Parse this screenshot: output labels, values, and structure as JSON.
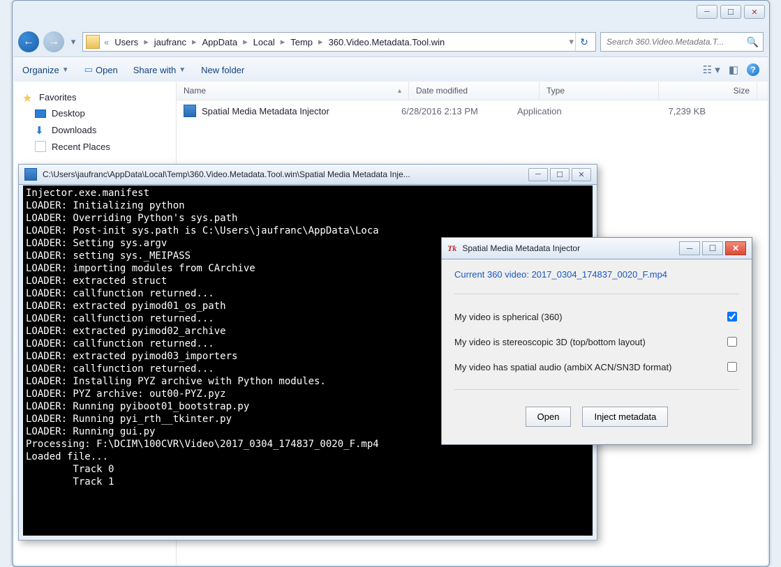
{
  "explorer": {
    "breadcrumb": {
      "prefix": "«",
      "items": [
        "Users",
        "jaufranc",
        "AppData",
        "Local",
        "Temp",
        "360.Video.Metadata.Tool.win"
      ]
    },
    "search_placeholder": "Search 360.Video.Metadata.T...",
    "toolbar": {
      "organize": "Organize",
      "open": "Open",
      "share": "Share with",
      "newfolder": "New folder"
    },
    "sidebar": {
      "favorites": "Favorites",
      "desktop": "Desktop",
      "downloads": "Downloads",
      "recent": "Recent Places"
    },
    "columns": {
      "name": "Name",
      "date": "Date modified",
      "type": "Type",
      "size": "Size"
    },
    "files": [
      {
        "name": "Spatial Media Metadata Injector",
        "date": "6/28/2016 2:13 PM",
        "type": "Application",
        "size": "7,239 KB"
      }
    ]
  },
  "console": {
    "title": "C:\\Users\\jaufranc\\AppData\\Local\\Temp\\360.Video.Metadata.Tool.win\\Spatial Media Metadata Inje...",
    "lines": [
      "Injector.exe.manifest",
      "LOADER: Initializing python",
      "LOADER: Overriding Python's sys.path",
      "LOADER: Post-init sys.path is C:\\Users\\jaufranc\\AppData\\Loca",
      "LOADER: Setting sys.argv",
      "LOADER: setting sys._MEIPASS",
      "LOADER: importing modules from CArchive",
      "LOADER: extracted struct",
      "LOADER: callfunction returned...",
      "LOADER: extracted pyimod01_os_path",
      "LOADER: callfunction returned...",
      "LOADER: extracted pyimod02_archive",
      "LOADER: callfunction returned...",
      "LOADER: extracted pyimod03_importers",
      "LOADER: callfunction returned...",
      "LOADER: Installing PYZ archive with Python modules.",
      "LOADER: PYZ archive: out00-PYZ.pyz",
      "LOADER: Running pyiboot01_bootstrap.py",
      "LOADER: Running pyi_rth__tkinter.py",
      "LOADER: Running gui.py",
      "Processing: F:\\DCIM\\100CVR\\Video\\2017_0304_174837_0020_F.mp4",
      "Loaded file...",
      "        Track 0",
      "        Track 1"
    ]
  },
  "injector": {
    "title": "Spatial Media Metadata Injector",
    "current_label": "Current 360 video: 2017_0304_174837_0020_F.mp4",
    "opt_spherical": "My video is spherical (360)",
    "opt_stereo": "My video is stereoscopic 3D (top/bottom layout)",
    "opt_audio": "My video has spatial audio (ambiX ACN/SN3D format)",
    "btn_open": "Open",
    "btn_inject": "Inject metadata",
    "checked": {
      "spherical": true,
      "stereo": false,
      "audio": false
    }
  }
}
